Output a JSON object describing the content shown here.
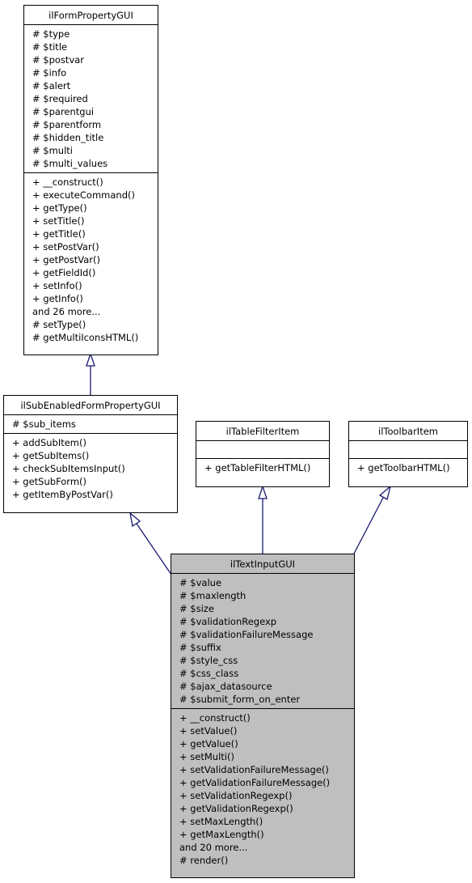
{
  "diagram": {
    "type": "uml-class-inheritance",
    "edge_color": "#191970",
    "focus_fill": "#bfbfbf",
    "classes": {
      "ilFormPropertyGUI": {
        "name": "ilFormPropertyGUI",
        "attributes": [
          "# $type",
          "# $title",
          "# $postvar",
          "# $info",
          "# $alert",
          "# $required",
          "# $parentgui",
          "# $parentform",
          "# $hidden_title",
          "# $multi",
          "# $multi_values"
        ],
        "methods": [
          "+ __construct()",
          "+ executeCommand()",
          "+ getType()",
          "+ setTitle()",
          "+ getTitle()",
          "+ setPostVar()",
          "+ getPostVar()",
          "+ getFieldId()",
          "+ setInfo()",
          "+ getInfo()",
          "and 26 more...",
          "# setType()",
          "# getMultiIconsHTML()"
        ]
      },
      "ilSubEnabledFormPropertyGUI": {
        "name": "ilSubEnabledFormPropertyGUI",
        "attributes": [
          "# $sub_items"
        ],
        "methods": [
          "+ addSubItem()",
          "+ getSubItems()",
          "+ checkSubItemsInput()",
          "+ getSubForm()",
          "+ getItemByPostVar()"
        ]
      },
      "ilTableFilterItem": {
        "name": "ilTableFilterItem",
        "attributes": [],
        "methods": [
          "+ getTableFilterHTML()"
        ]
      },
      "ilToolbarItem": {
        "name": "ilToolbarItem",
        "attributes": [],
        "methods": [
          "+ getToolbarHTML()"
        ]
      },
      "ilTextInputGUI": {
        "name": "ilTextInputGUI",
        "attributes": [
          "# $value",
          "# $maxlength",
          "# $size",
          "# $validationRegexp",
          "# $validationFailureMessage",
          "# $suffix",
          "# $style_css",
          "# $css_class",
          "# $ajax_datasource",
          "# $submit_form_on_enter"
        ],
        "methods": [
          "+ __construct()",
          "+ setValue()",
          "+ getValue()",
          "+ setMulti()",
          "+ setValidationFailureMessage()",
          "+ getValidationFailureMessage()",
          "+ setValidationRegexp()",
          "+ getValidationRegexp()",
          "+ setMaxLength()",
          "+ getMaxLength()",
          "and 20 more...",
          "# render()"
        ]
      }
    },
    "edges": [
      {
        "from": "ilSubEnabledFormPropertyGUI",
        "to": "ilFormPropertyGUI",
        "kind": "inheritance"
      },
      {
        "from": "ilTextInputGUI",
        "to": "ilSubEnabledFormPropertyGUI",
        "kind": "inheritance"
      },
      {
        "from": "ilTextInputGUI",
        "to": "ilTableFilterItem",
        "kind": "inheritance"
      },
      {
        "from": "ilTextInputGUI",
        "to": "ilToolbarItem",
        "kind": "inheritance"
      }
    ]
  }
}
